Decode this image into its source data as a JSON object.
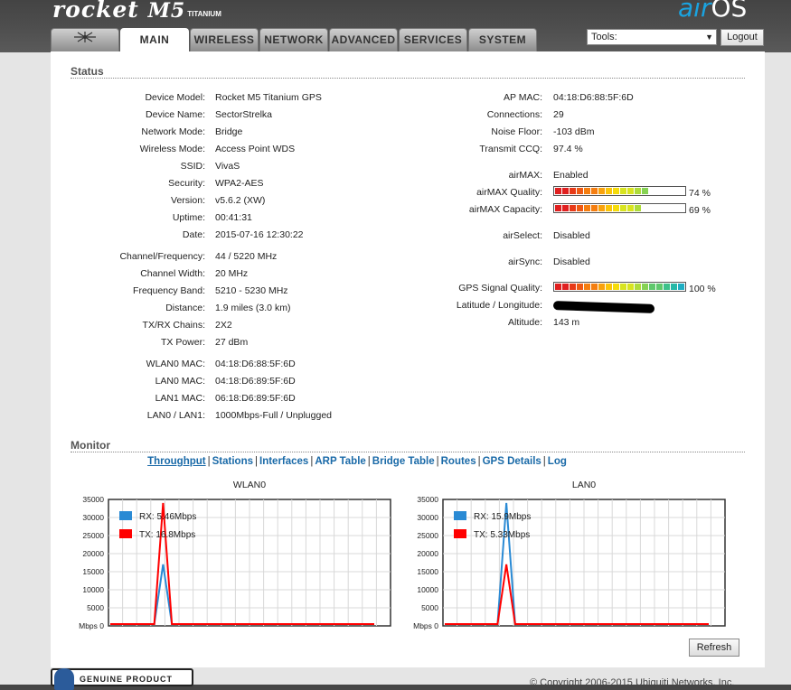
{
  "brand": {
    "logo": "rocket",
    "model": "M5",
    "edition": "TITANIUM",
    "os_air": "air",
    "os_name": "OS"
  },
  "tabs": [
    "MAIN",
    "WIRELESS",
    "NETWORK",
    "ADVANCED",
    "SERVICES",
    "SYSTEM"
  ],
  "active_tab": "MAIN",
  "toolbar": {
    "tools_value": "Tools:",
    "logout_label": "Logout"
  },
  "status": {
    "title": "Status",
    "left": [
      {
        "label": "Device Model:",
        "value": "Rocket M5 Titanium GPS"
      },
      {
        "label": "Device Name:",
        "value": "SectorStrelka"
      },
      {
        "label": "Network Mode:",
        "value": "Bridge"
      },
      {
        "label": "Wireless Mode:",
        "value": "Access Point WDS"
      },
      {
        "label": "SSID:",
        "value": "VivaS"
      },
      {
        "label": "Security:",
        "value": "WPA2-AES"
      },
      {
        "label": "Version:",
        "value": "v5.6.2 (XW)"
      },
      {
        "label": "Uptime:",
        "value": "00:41:31"
      },
      {
        "label": "Date:",
        "value": "2015-07-16 12:30:22"
      },
      {
        "label": "Channel/Frequency:",
        "value": "44 / 5220 MHz"
      },
      {
        "label": "Channel Width:",
        "value": "20 MHz"
      },
      {
        "label": "Frequency Band:",
        "value": "5210 - 5230 MHz"
      },
      {
        "label": "Distance:",
        "value": "1.9 miles (3.0 km)"
      },
      {
        "label": "TX/RX Chains:",
        "value": "2X2"
      },
      {
        "label": "TX Power:",
        "value": "27 dBm"
      },
      {
        "label": "WLAN0 MAC:",
        "value": "04:18:D6:88:5F:6D"
      },
      {
        "label": "LAN0 MAC:",
        "value": "04:18:D6:89:5F:6D"
      },
      {
        "label": "LAN1 MAC:",
        "value": "06:18:D6:89:5F:6D"
      },
      {
        "label": "LAN0 / LAN1:",
        "value": "1000Mbps-Full / Unplugged"
      }
    ],
    "right": [
      {
        "label": "AP MAC:",
        "value": "04:18:D6:88:5F:6D"
      },
      {
        "label": "Connections:",
        "value": "29"
      },
      {
        "label": "Noise Floor:",
        "value": "-103 dBm"
      },
      {
        "label": "Transmit CCQ:",
        "value": "97.4 %"
      },
      {
        "label": "airMAX:",
        "value": "Enabled"
      },
      {
        "label": "airMAX Quality:",
        "value": "74 %",
        "level": 74
      },
      {
        "label": "airMAX Capacity:",
        "value": "69 %",
        "level": 69
      },
      {
        "label": "airSelect:",
        "value": "Disabled"
      },
      {
        "label": "airSync:",
        "value": "Disabled"
      },
      {
        "label": "GPS Signal Quality:",
        "value": "100 %",
        "level": 100
      },
      {
        "label": "Latitude / Longitude:",
        "value": ""
      },
      {
        "label": "Altitude:",
        "value": "143 m"
      }
    ]
  },
  "monitor": {
    "title": "Monitor",
    "links": [
      "Throughput",
      "Stations",
      "Interfaces",
      "ARP Table",
      "Bridge Table",
      "Routes",
      "GPS Details",
      "Log"
    ],
    "selected_link": "Throughput",
    "refresh_label": "Refresh"
  },
  "colors": {
    "rx": "#2a8ad4",
    "tx": "#ff0000"
  },
  "chart_data": [
    {
      "type": "line",
      "title": "WLAN0",
      "yticks": [
        "35000",
        "30000",
        "25000",
        "20000",
        "15000",
        "10000",
        "5000",
        "Mbps 0"
      ],
      "ylim": [
        0,
        35000
      ],
      "x": [
        0,
        1,
        2,
        3,
        4,
        5,
        6,
        7,
        8,
        9,
        10,
        11,
        12,
        13,
        14,
        15,
        16,
        17,
        18,
        19,
        20,
        21,
        22,
        23,
        24,
        25,
        26,
        27,
        28,
        29,
        30
      ],
      "series": [
        {
          "name": "RX: 5.46Mbps",
          "values": [
            0,
            0,
            0,
            0,
            0,
            0,
            17000,
            0,
            0,
            0,
            0,
            0,
            0,
            0,
            0,
            0,
            0,
            0,
            0,
            0,
            0,
            0,
            0,
            0,
            0,
            0,
            0,
            0,
            0,
            0,
            0
          ]
        },
        {
          "name": "TX: 16.8Mbps",
          "values": [
            0,
            0,
            0,
            0,
            0,
            0,
            34500,
            0,
            0,
            0,
            0,
            0,
            0,
            0,
            0,
            0,
            0,
            0,
            0,
            0,
            0,
            0,
            0,
            0,
            0,
            0,
            0,
            0,
            0,
            0,
            0
          ]
        }
      ],
      "grid": true,
      "legend": "top-left"
    },
    {
      "type": "line",
      "title": "LAN0",
      "yticks": [
        "35000",
        "30000",
        "25000",
        "20000",
        "15000",
        "10000",
        "5000",
        "Mbps 0"
      ],
      "ylim": [
        0,
        35000
      ],
      "x": [
        0,
        1,
        2,
        3,
        4,
        5,
        6,
        7,
        8,
        9,
        10,
        11,
        12,
        13,
        14,
        15,
        16,
        17,
        18,
        19,
        20,
        21,
        22,
        23,
        24,
        25,
        26,
        27,
        28,
        29,
        30
      ],
      "series": [
        {
          "name": "RX: 15.9Mbps",
          "values": [
            0,
            0,
            0,
            0,
            0,
            0,
            0,
            34500,
            0,
            0,
            0,
            0,
            0,
            0,
            0,
            0,
            0,
            0,
            0,
            0,
            0,
            0,
            0,
            0,
            0,
            0,
            0,
            0,
            0,
            0,
            0
          ]
        },
        {
          "name": "TX: 5.33Mbps",
          "values": [
            0,
            0,
            0,
            0,
            0,
            0,
            0,
            17000,
            0,
            0,
            0,
            0,
            0,
            0,
            0,
            0,
            0,
            0,
            0,
            0,
            0,
            0,
            0,
            0,
            0,
            0,
            0,
            0,
            0,
            0,
            0
          ]
        }
      ],
      "grid": true,
      "legend": "top-left"
    }
  ],
  "footer": {
    "badge": "GENUINE  PRODUCT",
    "copyright": "© Copyright 2006-2015 Ubiquiti Networks, Inc."
  }
}
